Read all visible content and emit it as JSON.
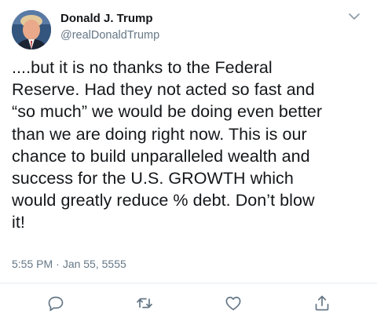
{
  "tweet": {
    "author": {
      "name": "Donald J. Trump",
      "handle": "@realDonaldTrump"
    },
    "text": "....but it is no thanks to the Federal\nReserve. Had they not acted so fast and\n“so much” we would be doing even better\nthan we are doing right now. This is our\nchance to build unparalleled wealth and\nsuccess for the U.S. GROWTH which\nwould greatly reduce % debt. Don’t blow\nit!",
    "time": "5:55 PM",
    "separator": "·",
    "date": "Jan 55, 5555"
  },
  "icons": {
    "menu": "chevron-down-icon",
    "reply": "reply-icon",
    "retweet": "retweet-icon",
    "like": "heart-icon",
    "share": "share-icon"
  },
  "colors": {
    "text": "#14171a",
    "secondary": "#657786",
    "icon": "#657786",
    "divider": "#e6ecf0"
  }
}
